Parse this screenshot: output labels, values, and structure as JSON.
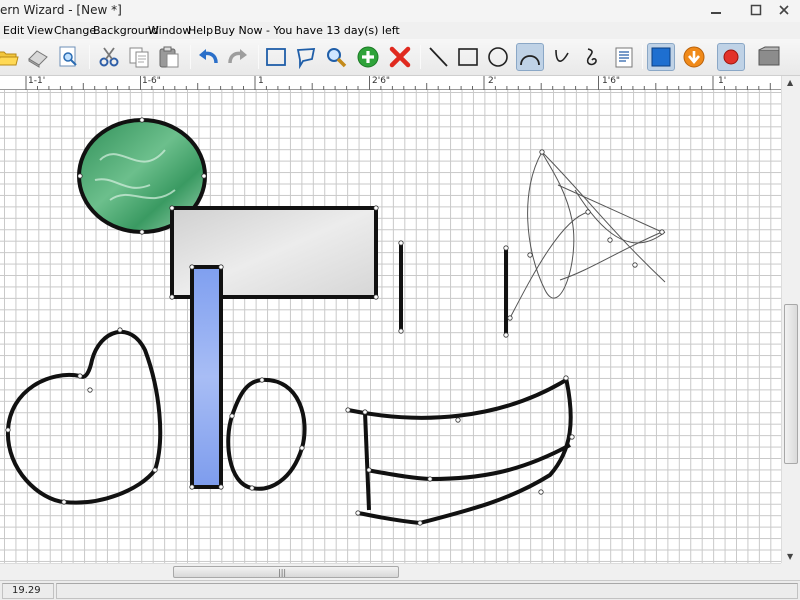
{
  "window": {
    "title": "ern Wizard - [New *]"
  },
  "menu": {
    "items": [
      "Edit",
      "View",
      "Change",
      "Background",
      "Window",
      "Help",
      "Buy Now - You have 13 day(s) left"
    ]
  },
  "toolbar": {
    "buttons": [
      {
        "icon": "open-folder-icon"
      },
      {
        "icon": "eraser-icon"
      },
      {
        "icon": "print-preview-icon"
      },
      {
        "icon": "cut-icon"
      },
      {
        "icon": "copy-icon"
      },
      {
        "icon": "paste-icon"
      },
      {
        "icon": "undo-icon"
      },
      {
        "icon": "redo-icon"
      },
      {
        "icon": "rectangle-select-icon"
      },
      {
        "icon": "lasso-select-icon"
      },
      {
        "icon": "zoom-icon"
      },
      {
        "icon": "add-point-icon"
      },
      {
        "icon": "delete-point-icon"
      },
      {
        "icon": "line-tool-icon"
      },
      {
        "icon": "rectangle-tool-icon"
      },
      {
        "icon": "ellipse-tool-icon"
      },
      {
        "icon": "arc-tool-icon",
        "active": true
      },
      {
        "icon": "curve-tool-icon"
      },
      {
        "icon": "spiral-tool-icon"
      },
      {
        "icon": "properties-icon"
      },
      {
        "icon": "fill-color-icon",
        "active": true
      },
      {
        "icon": "move-down-icon"
      },
      {
        "icon": "record-icon",
        "active": true
      },
      {
        "icon": "texture-icon"
      }
    ]
  },
  "ruler": {
    "labels": [
      "1-1'",
      "1-6\"",
      "1",
      "2'6\"",
      "2'",
      "1'6\"",
      "1'"
    ]
  },
  "status": {
    "coordinate": "19.29"
  },
  "colors": {
    "accent_blue": "#1e6fd0",
    "fill_green": "#3f9e68",
    "fill_gray": "#d9d9d9",
    "fill_blue": "#8aa6ef",
    "grid_line": "#c9c9c9"
  }
}
